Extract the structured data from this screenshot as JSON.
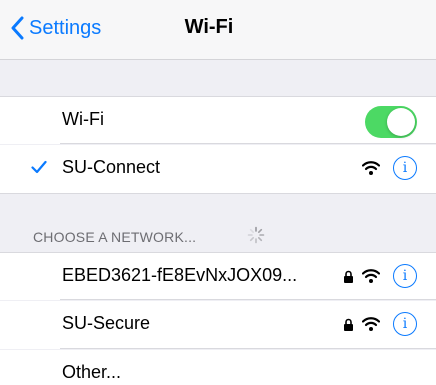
{
  "navbar": {
    "back_label": "Settings",
    "title": "Wi-Fi"
  },
  "wifi_toggle": {
    "label": "Wi-Fi",
    "on": true,
    "on_color": "#4cd964"
  },
  "connected": {
    "name": "SU-Connect",
    "icons": [
      "checkmark-icon",
      "wifi-icon",
      "info-icon"
    ]
  },
  "section": {
    "header": "CHOOSE A NETWORK..."
  },
  "networks": [
    {
      "name": "EBED3621-fE8EvNxJOX09...",
      "secured": true
    },
    {
      "name": "SU-Secure",
      "secured": true
    }
  ],
  "other": {
    "label": "Other..."
  },
  "info_glyph": "i",
  "accent": "#0a7aff"
}
